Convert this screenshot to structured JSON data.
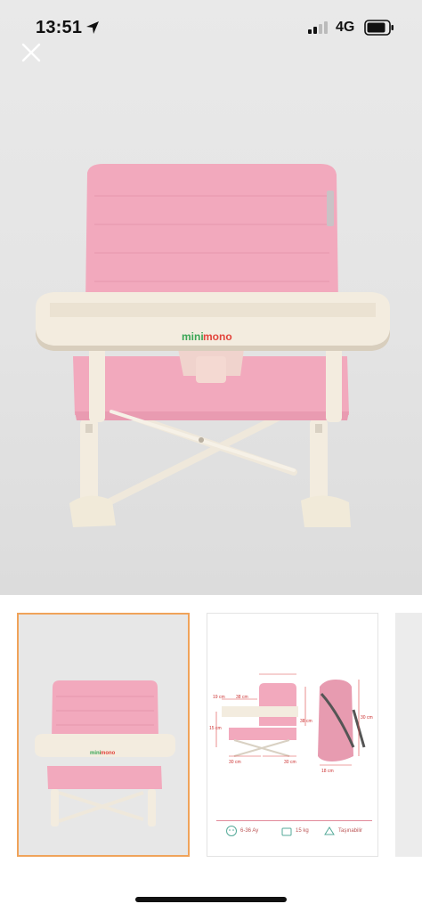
{
  "status_bar": {
    "time": "13:51",
    "location_icon": "location-arrow-icon",
    "signal_icon": "cellular-signal-icon",
    "network": "4G",
    "battery_icon": "battery-icon"
  },
  "viewer": {
    "close_icon": "close-icon",
    "brand_logo": "minimono"
  },
  "thumbnails": [
    {
      "selected": true,
      "content": "product-photo"
    },
    {
      "selected": false,
      "content": "dimensions-diagram",
      "dimensions": [
        "19 cm",
        "38 cm",
        "38 cm",
        "30 cm",
        "30 cm",
        "18 cm",
        "30 cm",
        "15 cm"
      ],
      "specs": [
        "6-36 Ay",
        "15 kg",
        "Taşınabilir"
      ]
    },
    {
      "selected": false,
      "content": "partial"
    }
  ],
  "colors": {
    "seat_pink": "#f2a9bd",
    "tray_cream": "#f3ecdf",
    "selected_border": "#f0a35a",
    "brand_green": "#3aa655",
    "brand_red": "#e2453c"
  }
}
